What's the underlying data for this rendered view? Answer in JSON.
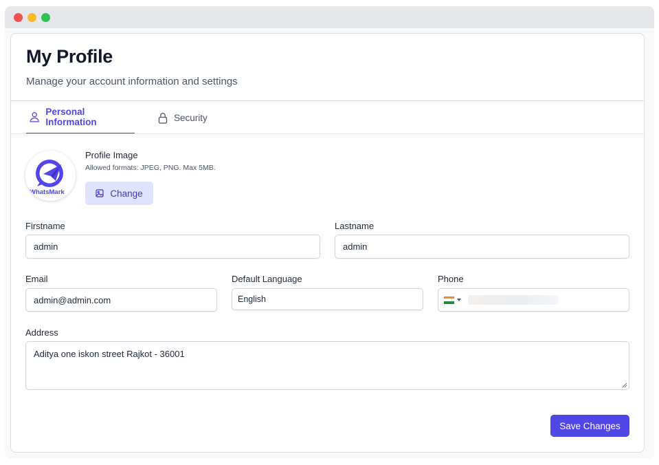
{
  "header": {
    "title": "My Profile",
    "subtitle": "Manage your account information and settings"
  },
  "tabs": [
    {
      "label": "Personal Information",
      "icon": "user-icon",
      "active": true
    },
    {
      "label": "Security",
      "icon": "lock-icon",
      "active": false
    }
  ],
  "profile_image": {
    "label": "Profile Image",
    "hint": "Allowed formats: JPEG, PNG. Max 5MB.",
    "change_label": "Change",
    "logo_text": "WhatsMark"
  },
  "form": {
    "firstname": {
      "label": "Firstname",
      "value": "admin"
    },
    "lastname": {
      "label": "Lastname",
      "value": "admin"
    },
    "email": {
      "label": "Email",
      "value": "admin@admin.com"
    },
    "language": {
      "label": "Default Language",
      "value": "English"
    },
    "phone": {
      "label": "Phone",
      "country_flag": "india-flag-icon"
    },
    "address": {
      "label": "Address",
      "value": "Aditya one iskon street Rajkot - 36001"
    }
  },
  "actions": {
    "save_label": "Save Changes"
  },
  "colors": {
    "accent": "#4f46e5",
    "accent_soft": "#e0e3fb"
  }
}
